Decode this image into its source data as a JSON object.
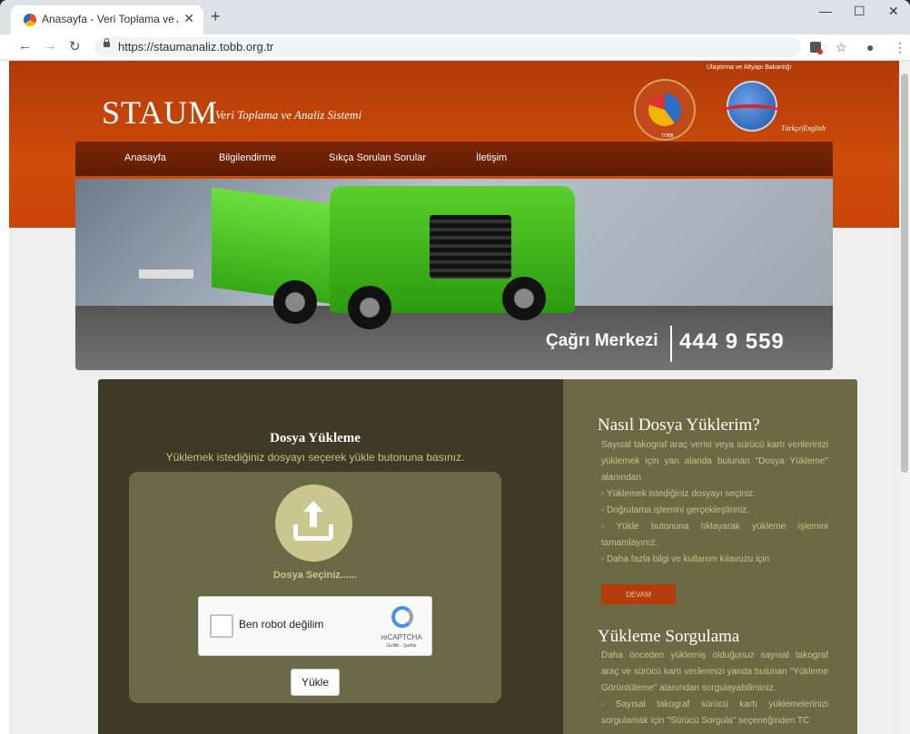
{
  "browser": {
    "tab_title": "Anasayfa - Veri Toplama ve Anali",
    "tab_close": "✕",
    "new_tab": "+",
    "url": "https://staumanaliz.tobb.org.tr",
    "minimize": "—",
    "maximize": "☐",
    "close": "✕",
    "back": "←",
    "forward": "→",
    "reload": "↻",
    "star": "☆",
    "profile": "●",
    "menu": "⋮"
  },
  "header": {
    "logo": "STAUM",
    "subtitle": "Veri Toplama ve Analiz Sistemi",
    "ministry_title": "Ulaştırma ve Altyapı Bakanlığı",
    "tobb_label": "TOBB",
    "lang_tr": "Türkçe",
    "lang_sep": "|",
    "lang_en": "English"
  },
  "nav": {
    "items": [
      "Anasayfa",
      "Bilgilendirme",
      "Sıkça Sorulan Sorular",
      "İletişim"
    ]
  },
  "banner": {
    "call_label": "Çağrı Merkezi",
    "call_number": "444 9 559"
  },
  "upload": {
    "title": "Dosya Yükleme",
    "description": "Yüklemek istediğiniz dosyayı seçerek yükle butonuna basınız.",
    "choose_label": "Dosya Seçiniz......",
    "captcha_label": "Ben robot değilim",
    "captcha_brand": "reCAPTCHA",
    "captcha_links": "Gizlilik - Şartlar",
    "submit_label": "Yükle"
  },
  "help": {
    "title": "Nasıl Dosya Yüklerim?",
    "lines": [
      "Sayısal takograf araç verisi veya sürücü kartı verilerinizi yüklemek için yan alanda bulunan \"Dosya Yükleme\" alanından",
      "- Yüklemek istediğiniz dosyayı seçiniz.",
      "- Doğrulama işlemini gerçekleştiriniz.",
      "- Yükle butonuna tıklayarak yükleme işlemini tamamlayınız.",
      "- Daha fazla bilgi ve kullanım kılavuzu için"
    ],
    "button": "DEVAM"
  },
  "query": {
    "title": "Yükleme Sorgulama",
    "lines": [
      "Daha önceden yüklemiş olduğunuz sayısal takograf araç ve sürücü kartı verilerinizi yanda bulunan \"Yükleme Görüntüleme\" alanından sorgulayabilirsiniz.",
      "- Sayısal takograf sürücü kartı yüklemelerinizi sorgulamak için \"Sürücü Sorgula\" seçeneğinden TC"
    ]
  }
}
